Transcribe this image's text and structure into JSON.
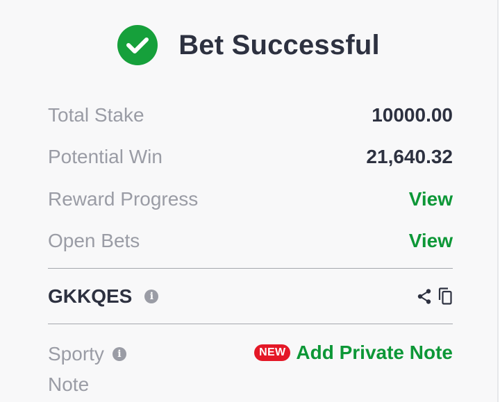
{
  "header": {
    "title": "Bet Successful",
    "icon": "check-circle-icon"
  },
  "summary": {
    "total_stake_label": "Total Stake",
    "total_stake_value": "10000.00",
    "potential_win_label": "Potential Win",
    "potential_win_value": "21,640.32",
    "reward_progress_label": "Reward Progress",
    "reward_progress_link": "View",
    "open_bets_label": "Open Bets",
    "open_bets_link": "View"
  },
  "booking": {
    "code": "GKKQES"
  },
  "note": {
    "label_line1": "Sporty",
    "label_line2": "Note",
    "badge": "NEW",
    "action": "Add Private Note"
  },
  "colors": {
    "accent_green": "#0d9737",
    "check_green": "#16a03b",
    "badge_red": "#e41827",
    "text_dark": "#2d3140",
    "text_muted": "#9a9ca5"
  }
}
